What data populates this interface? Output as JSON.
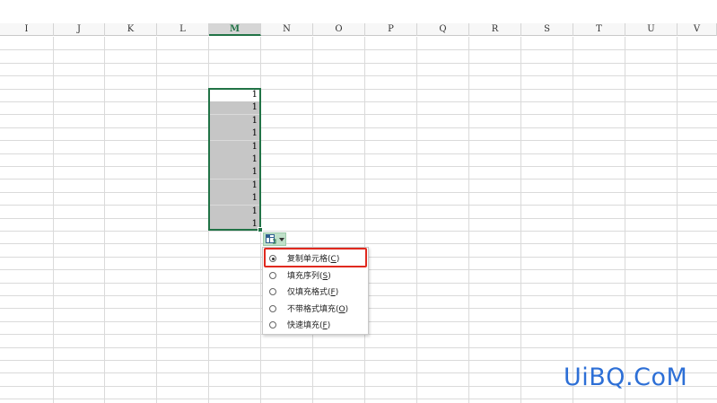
{
  "sheet": {
    "columns": [
      "I",
      "J",
      "K",
      "L",
      "M",
      "N",
      "O",
      "P",
      "Q",
      "R",
      "S",
      "T",
      "U",
      "V"
    ],
    "active_column": "M",
    "cells": [
      "1",
      "1",
      "1",
      "1",
      "1",
      "1",
      "1",
      "1",
      "1",
      "1",
      "1"
    ]
  },
  "autofill_menu": {
    "items": [
      {
        "label": "复制单元格(",
        "key": "C",
        "suffix": ")",
        "checked": true
      },
      {
        "label": "填充序列(",
        "key": "S",
        "suffix": ")",
        "checked": false
      },
      {
        "label": "仅填充格式(",
        "key": "F",
        "suffix": ")",
        "checked": false
      },
      {
        "label": "不带格式填充(",
        "key": "O",
        "suffix": ")",
        "checked": false
      },
      {
        "label": "快速填充(",
        "key": "F",
        "suffix": ")",
        "checked": false
      }
    ]
  },
  "colors": {
    "accent": "#217346",
    "highlight": "#e0291f",
    "selection": "#c6c6c6",
    "watermark": "#2d6fd6"
  },
  "watermark": {
    "text": "UiBQ.CoM"
  }
}
